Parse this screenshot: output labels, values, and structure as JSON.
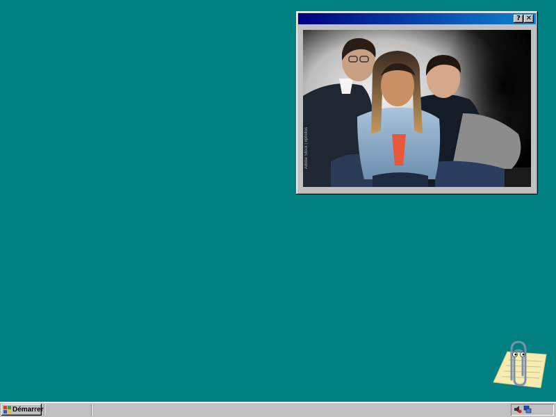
{
  "desktop": {
    "background_color": "#008080"
  },
  "photo_window": {
    "help_button_label": "?",
    "close_button_label": "✕",
    "photo_caption": "Adobe Stock | #photos",
    "title_gradient": [
      "#000080",
      "#1084d0"
    ]
  },
  "office_assistant": {
    "icon": "paperclip-assistant-icon"
  },
  "taskbar": {
    "start_label": "Démarrer",
    "tray_icons": [
      "volume-icon",
      "network-icon"
    ]
  }
}
